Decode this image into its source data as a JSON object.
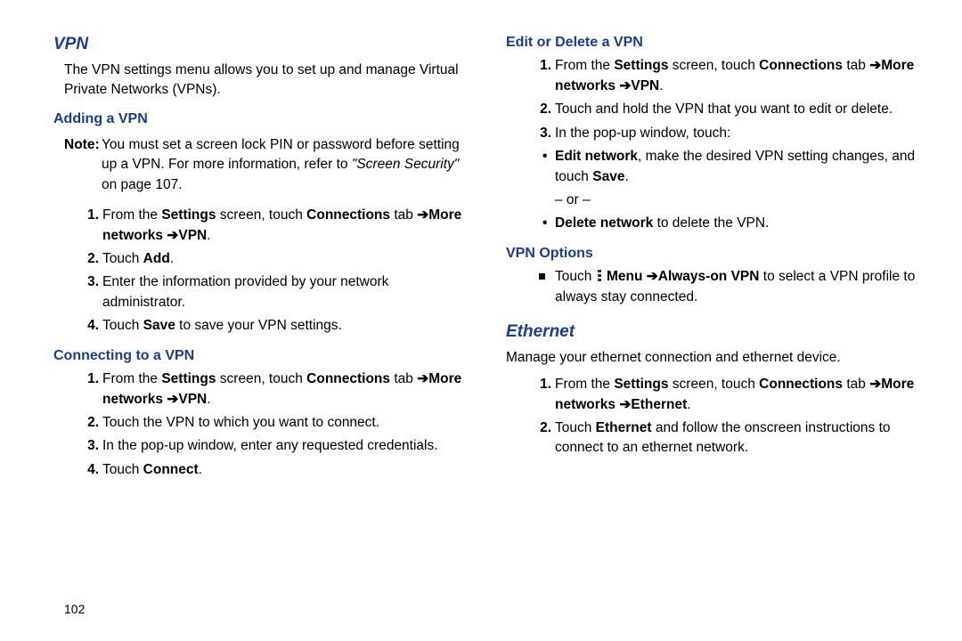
{
  "page_number": "102",
  "left": {
    "vpn_heading": "VPN",
    "vpn_intro": "The VPN settings menu allows you to set up and manage Virtual Private Networks (VPNs).",
    "adding_heading": "Adding a VPN",
    "note_label": "Note:",
    "note_text_1": "You must set a screen lock PIN or password before setting up a VPN. For more information, refer to ",
    "note_ref": "\"Screen Security\"",
    "note_text_2": " on page 107.",
    "add_step1_a": "From the ",
    "add_step1_b": "Settings",
    "add_step1_c": " screen, touch ",
    "add_step1_d": "Connections",
    "add_step1_e": " tab",
    "add_step1_f": "More networks",
    "add_step1_g": "VPN",
    "add_step2_a": "Touch ",
    "add_step2_b": "Add",
    "add_step3": "Enter the information provided by your network administrator.",
    "add_step4_a": "Touch ",
    "add_step4_b": "Save",
    "add_step4_c": " to save your VPN settings.",
    "connect_heading": "Connecting to a VPN",
    "conn_step1_a": "From the ",
    "conn_step1_b": "Settings",
    "conn_step1_c": " screen, touch ",
    "conn_step1_d": "Connections",
    "conn_step1_e": " tab",
    "conn_step1_f": "More networks",
    "conn_step1_g": "VPN",
    "conn_step2": "Touch the VPN to which you want to connect.",
    "conn_step3": "In the pop-up window, enter any requested credentials.",
    "conn_step4_a": "Touch ",
    "conn_step4_b": "Connect"
  },
  "right": {
    "edit_heading": "Edit or Delete a VPN",
    "edit_step1_a": "From the ",
    "edit_step1_b": "Settings",
    "edit_step1_c": " screen, touch ",
    "edit_step1_d": "Connections",
    "edit_step1_e": " tab",
    "edit_step1_f": "More networks",
    "edit_step1_g": "VPN",
    "edit_step2": "Touch and hold the VPN that you want to edit or delete.",
    "edit_step3": "In the pop-up window, touch:",
    "edit_bullet1_a": "Edit network",
    "edit_bullet1_b": ", make the desired VPN setting changes, and touch ",
    "edit_bullet1_c": "Save",
    "or_text": "– or –",
    "edit_bullet2_a": "Delete network",
    "edit_bullet2_b": " to delete the VPN.",
    "options_heading": "VPN Options",
    "opt_a": "Touch ",
    "opt_menu": "Menu",
    "opt_b": "Always-on VPN",
    "opt_c": " to select a VPN profile to always stay connected.",
    "eth_heading": "Ethernet",
    "eth_intro": "Manage your ethernet connection and ethernet device.",
    "eth_step1_a": "From the ",
    "eth_step1_b": "Settings",
    "eth_step1_c": " screen, touch ",
    "eth_step1_d": "Connections",
    "eth_step1_e": " tab",
    "eth_step1_f": "More networks",
    "eth_step1_g": "Ethernet",
    "eth_step2_a": "Touch ",
    "eth_step2_b": "Ethernet",
    "eth_step2_c": " and follow the onscreen instructions to connect to an ethernet network."
  }
}
